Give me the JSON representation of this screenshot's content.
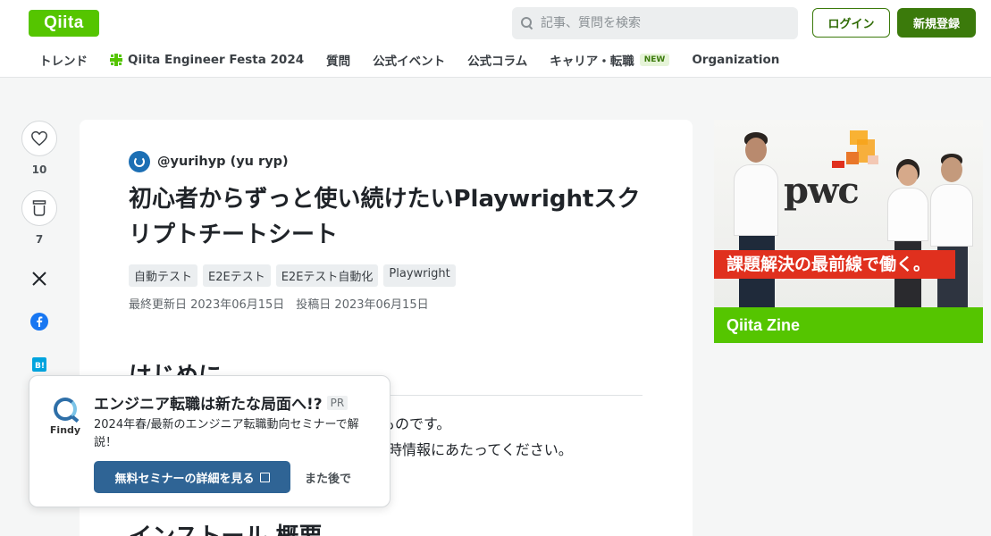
{
  "header": {
    "logo": "Qiita",
    "search_placeholder": "記事、質問を検索",
    "login_label": "ログイン",
    "signup_label": "新規登録",
    "nav": [
      {
        "label": "トレンド"
      },
      {
        "label": "Qiita Engineer Festa 2024",
        "icon": "festa-icon"
      },
      {
        "label": "質問"
      },
      {
        "label": "公式イベント"
      },
      {
        "label": "公式コラム"
      },
      {
        "label": "キャリア・転職",
        "badge": "NEW"
      },
      {
        "label": "Organization"
      }
    ]
  },
  "actions": {
    "like_count": "10",
    "stock_count": "7",
    "icons": [
      "heart-icon",
      "stock-icon",
      "x-icon",
      "facebook-icon",
      "hatena-bookmark-icon"
    ]
  },
  "article": {
    "author": "@yurihyp (yu ryp)",
    "title": "初心者からずっと使い続けたいPlaywrightスクリプトチートシート",
    "tags": [
      "自動テスト",
      "E2Eテスト",
      "E2Eテスト自動化",
      "Playwright"
    ],
    "dates": "最終更新日 2023年06月15日　投稿日 2023年06月15日",
    "heading1": "はじめに",
    "para_line1": "ものです。",
    "para_line2": "時情報にあたってください。",
    "heading2": "インストール 概要"
  },
  "ad": {
    "logo": "pwc",
    "banner": "課題解決の最前線で働く。",
    "footer": "Qiita Zine",
    "colors": {
      "brand_red": "#e0301e",
      "qiita_green": "#55c500"
    }
  },
  "popup": {
    "brand": "Findy",
    "title": "エンジニア転職は新たな局面へ!?",
    "pr": "PR",
    "description": "2024年春/最新のエンジニア転職動向セミナーで解説！",
    "cta": "無料セミナーの詳細を見る",
    "later": "また後で"
  }
}
